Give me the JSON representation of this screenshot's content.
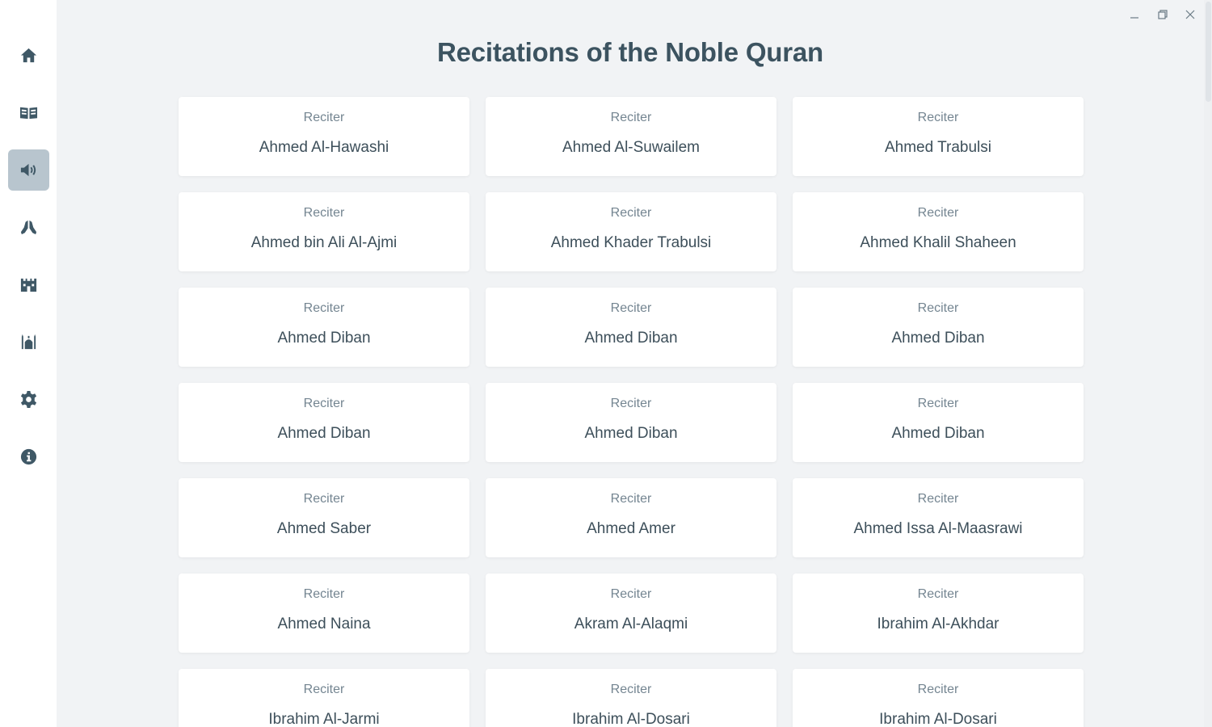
{
  "page": {
    "title": "Recitations of the Noble Quran"
  },
  "sidebar": {
    "items": [
      {
        "icon": "home-icon",
        "active": false
      },
      {
        "icon": "book-open-icon",
        "active": false
      },
      {
        "icon": "volume-icon",
        "active": true
      },
      {
        "icon": "praying-hands-icon",
        "active": false
      },
      {
        "icon": "kaaba-icon",
        "active": false
      },
      {
        "icon": "mosque-icon",
        "active": false
      },
      {
        "icon": "gear-icon",
        "active": false
      },
      {
        "icon": "info-icon",
        "active": false
      }
    ]
  },
  "reciters": [
    {
      "role": "Reciter",
      "name": "Ahmed Al-Hawashi"
    },
    {
      "role": "Reciter",
      "name": "Ahmed Al-Suwailem"
    },
    {
      "role": "Reciter",
      "name": "Ahmed Trabulsi"
    },
    {
      "role": "Reciter",
      "name": "Ahmed bin Ali Al-Ajmi"
    },
    {
      "role": "Reciter",
      "name": "Ahmed Khader Trabulsi"
    },
    {
      "role": "Reciter",
      "name": "Ahmed Khalil Shaheen"
    },
    {
      "role": "Reciter",
      "name": "Ahmed Diban"
    },
    {
      "role": "Reciter",
      "name": "Ahmed Diban"
    },
    {
      "role": "Reciter",
      "name": "Ahmed Diban"
    },
    {
      "role": "Reciter",
      "name": "Ahmed Diban"
    },
    {
      "role": "Reciter",
      "name": "Ahmed Diban"
    },
    {
      "role": "Reciter",
      "name": "Ahmed Diban"
    },
    {
      "role": "Reciter",
      "name": "Ahmed Saber"
    },
    {
      "role": "Reciter",
      "name": "Ahmed Amer"
    },
    {
      "role": "Reciter",
      "name": "Ahmed Issa Al-Maasrawi"
    },
    {
      "role": "Reciter",
      "name": "Ahmed Naina"
    },
    {
      "role": "Reciter",
      "name": "Akram Al-Alaqmi"
    },
    {
      "role": "Reciter",
      "name": "Ibrahim Al-Akhdar"
    },
    {
      "role": "Reciter",
      "name": "Ibrahim Al-Jarmi"
    },
    {
      "role": "Reciter",
      "name": "Ibrahim Al-Dosari"
    },
    {
      "role": "Reciter",
      "name": "Ibrahim Al-Dosari"
    }
  ],
  "colors": {
    "background": "#f1f3f5",
    "sidebar": "#ffffff",
    "active_nav": "#b8c5ce",
    "icon": "#3f5866",
    "title": "#3c5360"
  }
}
